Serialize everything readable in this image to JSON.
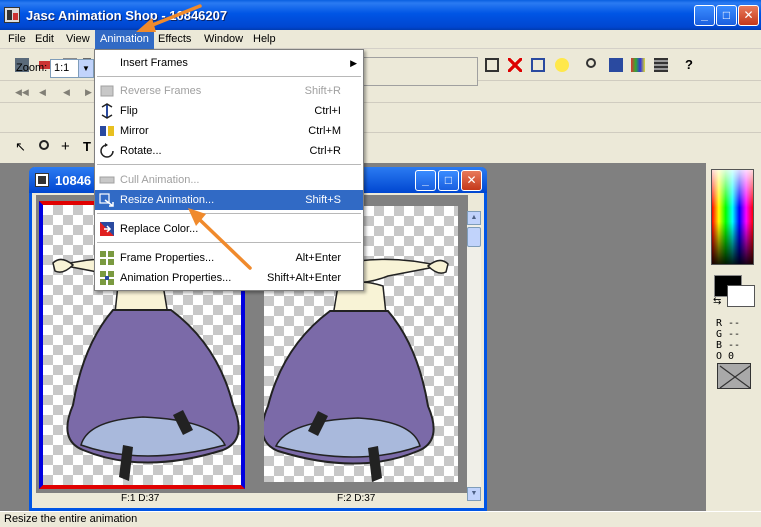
{
  "window": {
    "title": "Jasc Animation Shop - 10846207",
    "min_label": "_",
    "max_label": "□",
    "close_label": "✕"
  },
  "menubar": {
    "items": [
      "File",
      "Edit",
      "View",
      "Animation",
      "Effects",
      "Window",
      "Help"
    ]
  },
  "toolbar": {
    "zoom_label": "Zoom:",
    "zoom_value": "1:1"
  },
  "animation_menu": {
    "items": [
      {
        "label": "Insert Frames",
        "shortcut": "",
        "submenu": true
      },
      {
        "label": "Reverse Frames",
        "shortcut": "Shift+R",
        "disabled": true
      },
      {
        "label": "Flip",
        "shortcut": "Ctrl+I"
      },
      {
        "label": "Mirror",
        "shortcut": "Ctrl+M"
      },
      {
        "label": "Rotate...",
        "shortcut": "Ctrl+R"
      },
      {
        "label": "Cull Animation...",
        "shortcut": "",
        "disabled": true
      },
      {
        "label": "Resize Animation...",
        "shortcut": "Shift+S",
        "highlighted": true
      },
      {
        "label": "Replace Color...",
        "shortcut": ""
      },
      {
        "label": "Frame Properties...",
        "shortcut": "Alt+Enter"
      },
      {
        "label": "Animation Properties...",
        "shortcut": "Shift+Alt+Enter"
      }
    ]
  },
  "document": {
    "title": "10846",
    "frames": [
      {
        "label": "F:1   D:37"
      },
      {
        "label": "F:2   D:37"
      }
    ]
  },
  "palette": {
    "readout": [
      "R --",
      "G --",
      "B --",
      "O 0"
    ],
    "swap_icon": "swap-colors-icon"
  },
  "status": {
    "text": "Resize the entire animation"
  },
  "colors": {
    "titlebar": "#0055e5",
    "highlight": "#316ac5",
    "annotation_arrow": "#f08a2c",
    "dress": "#7b6aa8"
  }
}
